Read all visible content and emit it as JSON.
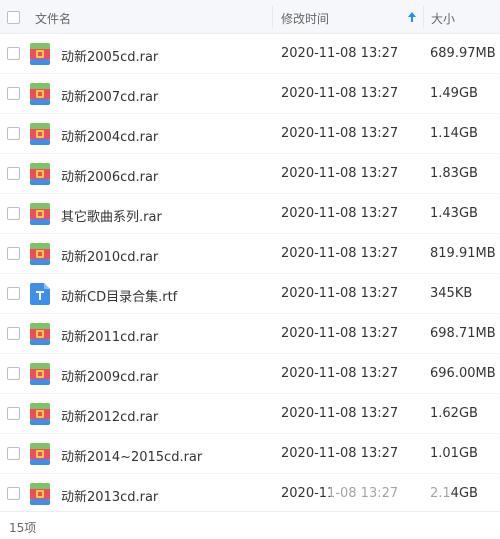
{
  "header": {
    "name_label": "文件名",
    "modified_label": "修改时间",
    "size_label": "大小"
  },
  "colors": {
    "accent": "#1e90ff",
    "archive_icon_green": "#7cc36b",
    "archive_icon_red": "#e9505a",
    "archive_icon_orange": "#f2a33b",
    "archive_icon_blue": "#3f8ee8",
    "doc_icon_blue": "#3f8ee8"
  },
  "files": [
    {
      "name": "动新2005cd.rar",
      "modified": "2020-11-08 13:27",
      "size": "689.97MB",
      "icon": "archive-icon"
    },
    {
      "name": "动新2007cd.rar",
      "modified": "2020-11-08 13:27",
      "size": "1.49GB",
      "icon": "archive-icon"
    },
    {
      "name": "动新2004cd.rar",
      "modified": "2020-11-08 13:27",
      "size": "1.14GB",
      "icon": "archive-icon"
    },
    {
      "name": "动新2006cd.rar",
      "modified": "2020-11-08 13:27",
      "size": "1.83GB",
      "icon": "archive-icon"
    },
    {
      "name": "其它歌曲系列.rar",
      "modified": "2020-11-08 13:27",
      "size": "1.43GB",
      "icon": "archive-icon"
    },
    {
      "name": "动新2010cd.rar",
      "modified": "2020-11-08 13:27",
      "size": "819.91MB",
      "icon": "archive-icon"
    },
    {
      "name": "动新CD目录合集.rtf",
      "modified": "2020-11-08 13:27",
      "size": "345KB",
      "icon": "document-icon"
    },
    {
      "name": "动新2011cd.rar",
      "modified": "2020-11-08 13:27",
      "size": "698.71MB",
      "icon": "archive-icon"
    },
    {
      "name": "动新2009cd.rar",
      "modified": "2020-11-08 13:27",
      "size": "696.00MB",
      "icon": "archive-icon"
    },
    {
      "name": "动新2012cd.rar",
      "modified": "2020-11-08 13:27",
      "size": "1.62GB",
      "icon": "archive-icon"
    },
    {
      "name": "动新2014~2015cd.rar",
      "modified": "2020-11-08 13:27",
      "size": "1.01GB",
      "icon": "archive-icon"
    },
    {
      "name": "动新2013cd.rar",
      "modified": "2020-11-08 13:27",
      "size": "2.14GB",
      "icon": "archive-icon"
    }
  ],
  "footer": {
    "item_count": "15项"
  }
}
